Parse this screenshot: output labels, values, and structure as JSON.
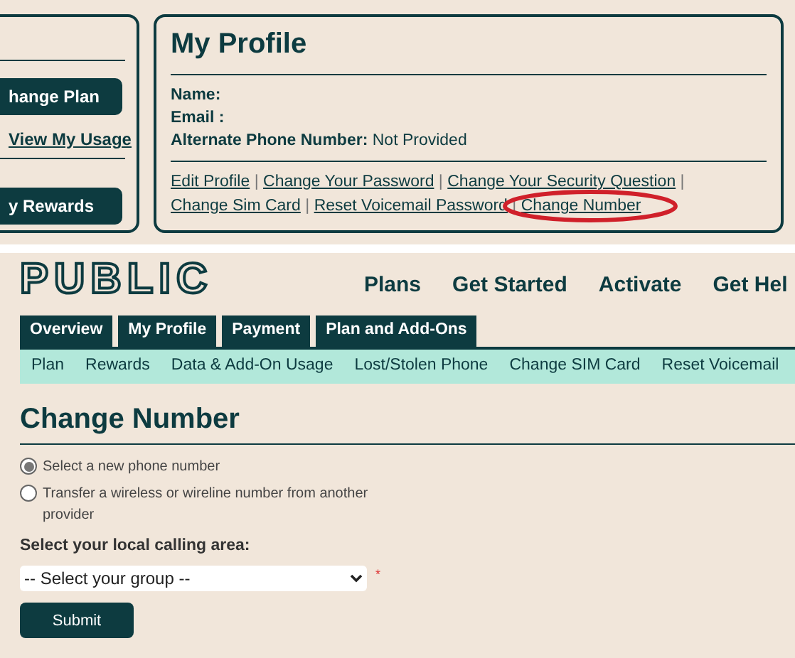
{
  "sidebar": {
    "buttons": [
      "hange Plan",
      "y Rewards"
    ],
    "link": "View My Usage"
  },
  "profile": {
    "title": "My Profile",
    "fields": [
      {
        "label": "Name:"
      },
      {
        "label": "Email :"
      },
      {
        "label": "Alternate Phone Number:",
        "value": "Not Provided"
      }
    ],
    "links": [
      {
        "label": "Edit Profile",
        "highlighted": false
      },
      {
        "label": "Change Your Password",
        "highlighted": false
      },
      {
        "label": "Change Your Security Question",
        "highlighted": false
      },
      {
        "label": "Change Sim Card",
        "highlighted": false
      },
      {
        "label": "Reset Voicemail Password",
        "highlighted": false
      },
      {
        "label": "Change Number",
        "highlighted": true
      }
    ],
    "separator": "|"
  },
  "header": {
    "logo": "PUBLIC",
    "nav": [
      "Plans",
      "Get Started",
      "Activate",
      "Get Hel"
    ]
  },
  "tabs": [
    {
      "label": "Overview",
      "selected": false
    },
    {
      "label": "My Profile",
      "selected": false
    },
    {
      "label": "Payment",
      "selected": false
    },
    {
      "label": "Plan and Add-Ons",
      "selected": false
    }
  ],
  "subnav": [
    "Plan",
    "Rewards",
    "Data & Add-On Usage",
    "Lost/Stolen Phone",
    "Change SIM Card",
    "Reset Voicemail"
  ],
  "form": {
    "title": "Change Number",
    "options": [
      {
        "label": "Select a new phone number",
        "selected": true
      },
      {
        "label": "Transfer a wireless or wireline number from another provider",
        "selected": false
      }
    ],
    "area_label": "Select your local calling area:",
    "select": {
      "placeholder": "-- Select your group --",
      "required_mark": "*"
    },
    "submit": "Submit"
  }
}
